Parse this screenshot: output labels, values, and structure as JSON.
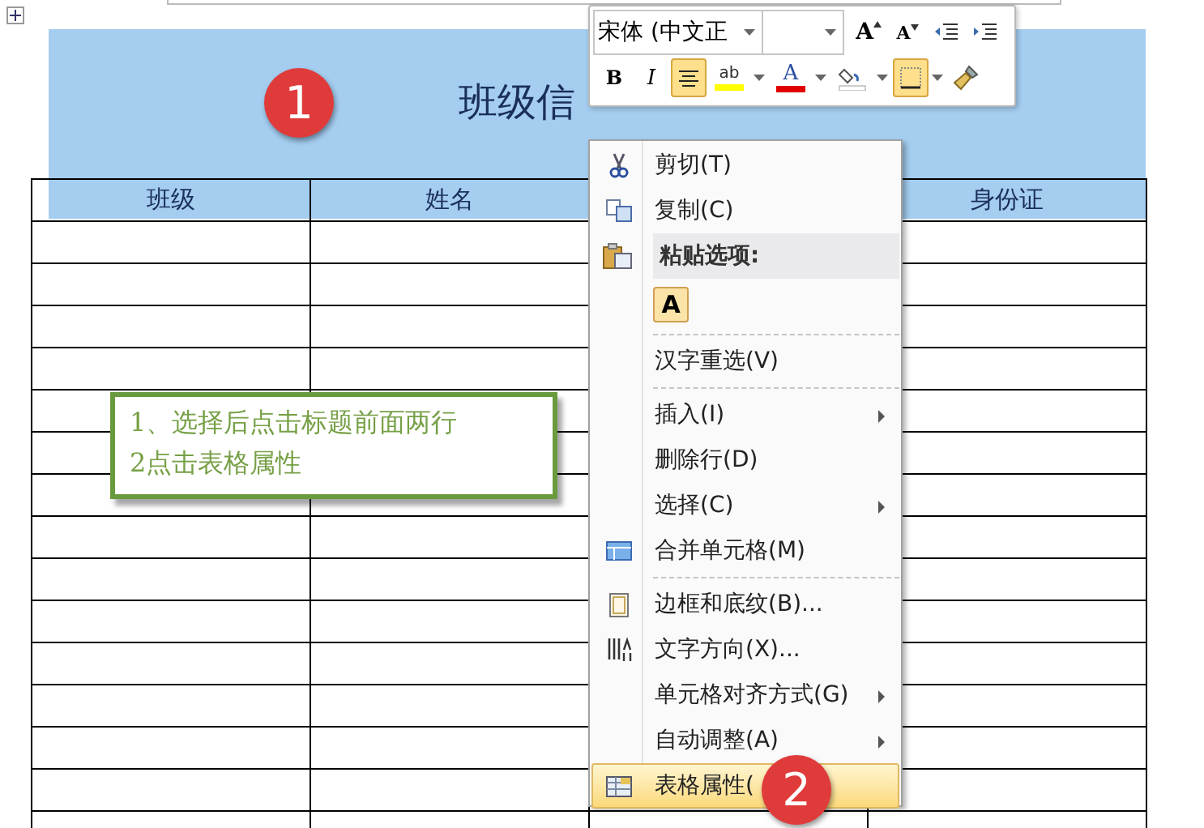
{
  "title_band": {
    "title": "班级信",
    "badge": "1"
  },
  "table": {
    "columns": [
      {
        "label": "班级"
      },
      {
        "label": "姓名"
      },
      {},
      {
        "label": "身份证"
      }
    ]
  },
  "note": {
    "lines": [
      "1、选择后点击标题前面两行",
      "2点击表格属性"
    ]
  },
  "mini_toolbar": {
    "font": "宋体 (中文正",
    "buttons": [
      {
        "kind": "grow-font",
        "label": "A",
        "selected": false
      },
      {
        "kind": "shrink-font",
        "label": "A",
        "selected": false
      },
      {
        "kind": "outdent",
        "selected": false
      },
      {
        "kind": "indent",
        "selected": false
      },
      {
        "kind": "bold",
        "label": "B",
        "selected": false
      },
      {
        "kind": "italic",
        "label": "I",
        "selected": false
      },
      {
        "kind": "center",
        "selected": true
      },
      {
        "kind": "highlight",
        "label": "ab",
        "color": "#ffff00",
        "selected": false
      },
      {
        "kind": "font-color",
        "label": "A",
        "color": "#e00000",
        "selected": false
      },
      {
        "kind": "shading",
        "selected": false
      },
      {
        "kind": "borders",
        "selected": true
      },
      {
        "kind": "painter",
        "selected": false
      }
    ]
  },
  "context_menu": {
    "badge": "2",
    "items": [
      {
        "kind": "item",
        "label": "剪切(T)",
        "submenu": false,
        "selected": false
      },
      {
        "kind": "item",
        "label": "复制(C)",
        "submenu": false,
        "selected": false
      },
      {
        "kind": "header",
        "label": "粘贴选项:"
      },
      {
        "kind": "paste-option",
        "label": "A"
      },
      {
        "kind": "separator"
      },
      {
        "kind": "item",
        "label": "汉字重选(V)",
        "submenu": false,
        "selected": false
      },
      {
        "kind": "separator"
      },
      {
        "kind": "item",
        "label": "插入(I)",
        "submenu": true,
        "selected": false
      },
      {
        "kind": "item",
        "label": "删除行(D)",
        "submenu": false,
        "selected": false
      },
      {
        "kind": "item",
        "label": "选择(C)",
        "submenu": true,
        "selected": false
      },
      {
        "kind": "item",
        "label": "合并单元格(M)",
        "submenu": false,
        "selected": false
      },
      {
        "kind": "separator"
      },
      {
        "kind": "item",
        "label": "边框和底纹(B)...",
        "submenu": false,
        "selected": false
      },
      {
        "kind": "item",
        "label": "文字方向(X)...",
        "submenu": false,
        "selected": false
      },
      {
        "kind": "item",
        "label": "单元格对齐方式(G)",
        "submenu": true,
        "selected": false
      },
      {
        "kind": "item",
        "label": "自动调整(A)",
        "submenu": true,
        "selected": false
      },
      {
        "kind": "item",
        "label": "表格属性(",
        "submenu": false,
        "selected": true
      }
    ]
  }
}
